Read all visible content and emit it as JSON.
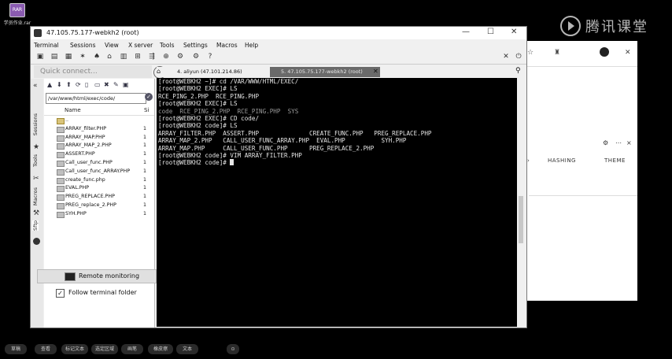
{
  "desktop": {
    "icon_badge": "RAR",
    "icon_label": "学员作业.rar",
    "watermark": "腾讯课堂"
  },
  "browser": {
    "icons": [
      "star-icon",
      "extension-icon",
      "profile-icon",
      "close-icon"
    ],
    "tool_gear": "⚙",
    "tool_more": "⋯",
    "tool_close": "×",
    "tabs": [
      "HASHING",
      "THEME"
    ]
  },
  "window": {
    "title": "47.105.75.177-webkh2 (root)",
    "menu": [
      "Terminal",
      "Sessions",
      "View",
      "X server",
      "Tools",
      "Settings",
      "Macros",
      "Help"
    ],
    "minimize": "—",
    "maximize": "☐",
    "close": "✕"
  },
  "quick_connect": {
    "placeholder": "Quick connect...",
    "help": "?"
  },
  "side_tabs": [
    "Sessions",
    "Tools",
    "Macros",
    "Sftp"
  ],
  "sftp": {
    "path": "/var/www/html/exec/code/",
    "columns": {
      "name": "Name",
      "size": "Si"
    },
    "files": [
      {
        "name": "..",
        "size": ""
      },
      {
        "name": "ARRAY_filter.PHP",
        "size": "1"
      },
      {
        "name": "ARRAY_MAP.PHP",
        "size": "1"
      },
      {
        "name": "ARRAY_MAP_2.PHP",
        "size": "1"
      },
      {
        "name": "ASSERT.PHP",
        "size": "1"
      },
      {
        "name": "Call_user_func.PHP",
        "size": "1"
      },
      {
        "name": "Call_user_func_ARRAY.PHP",
        "size": "1"
      },
      {
        "name": "create_func.php",
        "size": "1"
      },
      {
        "name": "EVAL.PHP",
        "size": "1"
      },
      {
        "name": "PREG_REPLACE.PHP",
        "size": "1"
      },
      {
        "name": "PREG_replace_2.PHP",
        "size": "1"
      },
      {
        "name": "SYH.PHP",
        "size": "1"
      }
    ],
    "remote_monitoring": "Remote monitoring",
    "follow_terminal": "Follow terminal folder",
    "follow_checked": "✓"
  },
  "terminal": {
    "tabs": [
      "4. aliyun (47.101.214.86)",
      "5. 47.105.75.177-webkh2 (root)"
    ],
    "lines": [
      "[root@WEBKH2 ~]# cd /VAR/WWW/HTML/EXEC/",
      "[root@WEBKH2 EXEC]# LS",
      "RCE_PING_2.PHP  RCE_PING.PHP",
      "[root@WEBKH2 EXEC]# LS",
      "code  RCE_PING_2.PHP  RCE_PING.PHP  SYS",
      "[root@WEBKH2 EXEC]# CD code/",
      "[root@WEBKH2 code]# LS",
      "ARRAY_FILTER.PHP  ASSERT.PHP              CREATE_FUNC.PHP   PREG_REPLACE.PHP",
      "ARRAY_MAP_2.PHP   CALL_USER_FUNC_ARRAY.PHP  EVAL.PHP          SYH.PHP",
      "ARRAY_MAP.PHP     CALL_USER_FUNC.PHP      PREG_REPLACE_2.PHP",
      "[root@WEBKH2 code]# VIM ARRAY_FILTER.PHP",
      "[root@WEBKH2 code]# "
    ]
  },
  "taskbar": [
    "草稿",
    "查看",
    "标记文本",
    "选定区域",
    "画笔",
    "橡皮擦",
    "文本",
    "⊙"
  ]
}
